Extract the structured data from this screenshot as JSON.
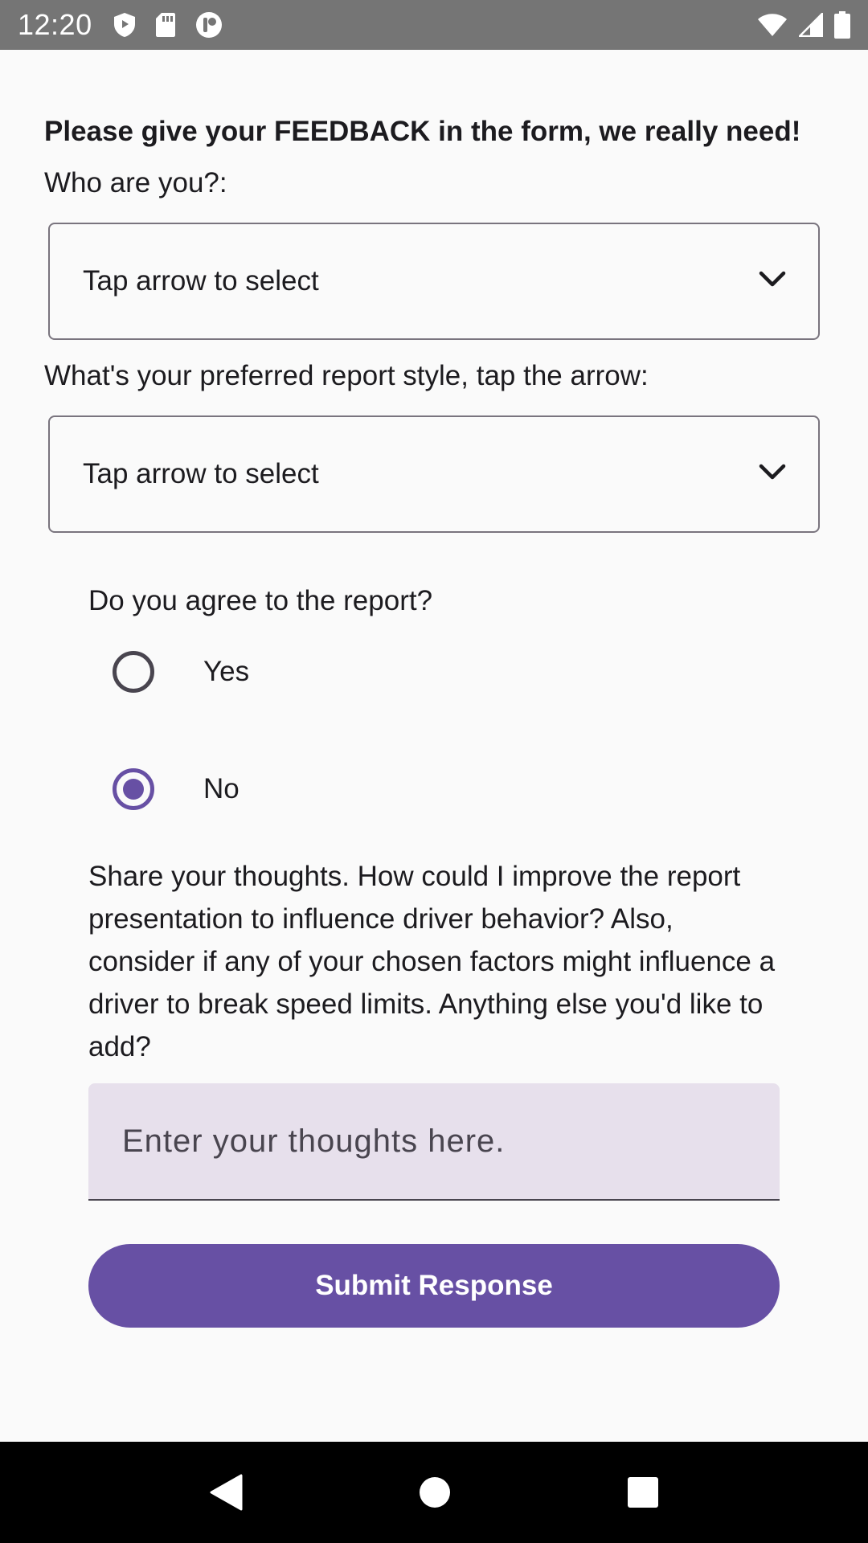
{
  "status_bar": {
    "time": "12:20",
    "icons": [
      "shield-icon",
      "sd-card-icon",
      "sync-icon"
    ],
    "right_icons": [
      "wifi-icon",
      "signal-icon",
      "battery-icon"
    ]
  },
  "form": {
    "heading": "Please give your FEEDBACK in the form, we really need!",
    "who_label": "Who are you?:",
    "who_dropdown": {
      "value": "Tap arrow to select",
      "icon": "chevron-down-icon"
    },
    "style_label": "What's your preferred report style, tap the arrow:",
    "style_dropdown": {
      "value": "Tap arrow to select",
      "icon": "chevron-down-icon"
    },
    "agree_question": "Do you agree to the report?",
    "options": [
      {
        "label": "Yes",
        "selected": false
      },
      {
        "label": "No",
        "selected": true
      }
    ],
    "thoughts_prompt": "Share your thoughts. How could I improve the report presentation to influence driver behavior? Also, consider if any of your chosen factors might influence a driver to break speed limits. Anything else you'd like to add?",
    "thoughts_field": {
      "value": "",
      "placeholder": "Enter your thoughts here."
    },
    "submit_label": "Submit Response"
  },
  "nav_bar": {
    "buttons": [
      "back-icon",
      "home-icon",
      "recents-icon"
    ]
  },
  "colors": {
    "accent": "#6750a4",
    "text_field_bg": "#e7e0ec",
    "status_bar_bg": "#757575",
    "nav_bar_bg": "#000000",
    "background": "#fafafa"
  }
}
